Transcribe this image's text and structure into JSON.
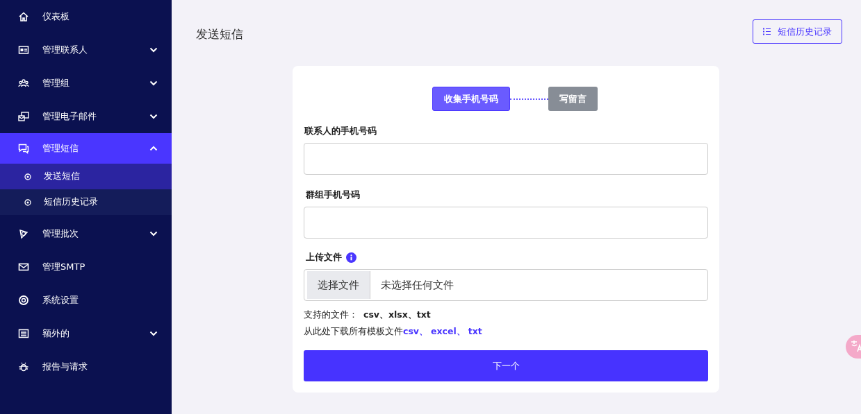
{
  "sidebar": {
    "items": [
      {
        "label": "仪表板",
        "kind": "home",
        "selected": false
      },
      {
        "label": "管理联系人",
        "kind": "idcard",
        "selected": false,
        "expanded": false
      },
      {
        "label": "管理组",
        "kind": "group",
        "selected": false,
        "expanded": false
      },
      {
        "label": "管理电子邮件",
        "kind": "email",
        "selected": false,
        "expanded": false
      },
      {
        "label": "管理短信",
        "kind": "chat",
        "selected": true,
        "expanded": true,
        "children": [
          {
            "label": "发送短信",
            "selected": true
          },
          {
            "label": "短信历史记录",
            "selected": false
          }
        ]
      },
      {
        "label": "管理批次",
        "kind": "batch",
        "selected": false,
        "expanded": false
      },
      {
        "label": "管理SMTP",
        "kind": "mail",
        "selected": false
      },
      {
        "label": "系统设置",
        "kind": "settings",
        "selected": false
      },
      {
        "label": "额外的",
        "kind": "list",
        "selected": false,
        "expanded": false
      },
      {
        "label": "报告与请求",
        "kind": "bug",
        "selected": false
      }
    ]
  },
  "page": {
    "title": "发送短信",
    "history_button": "短信历史记录"
  },
  "form": {
    "steps": [
      {
        "label": "收集手机号码",
        "selected": true
      },
      {
        "label": "写留言",
        "selected": false
      }
    ],
    "fields": [
      {
        "label": "联系人的手机号码"
      },
      {
        "label": "群组手机号码"
      }
    ],
    "upload": {
      "label": "上传文件",
      "choose_button": "选择文件",
      "status": "未选择任何文件"
    },
    "supported": "支持的文件： **csv、xlsx、txt**",
    "download": {
      "text": "从此处下载所有模板文件",
      "links": [
        "csv、",
        "excel、",
        "txt"
      ]
    },
    "submit": "下一个"
  }
}
